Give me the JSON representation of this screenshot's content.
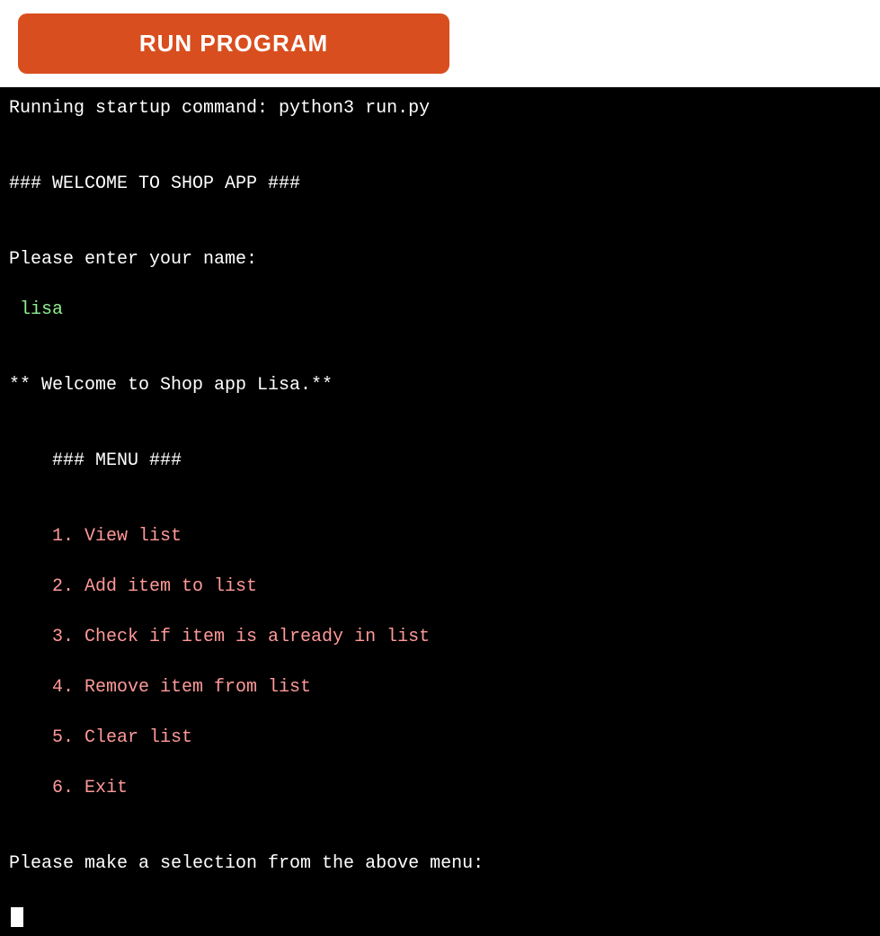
{
  "header": {
    "run_button_label": "RUN PROGRAM"
  },
  "terminal": {
    "lines": [
      {
        "text": "Running startup command: python3 run.py",
        "type": "normal"
      },
      {
        "text": "",
        "type": "normal"
      },
      {
        "text": "### WELCOME TO SHOP APP ###",
        "type": "normal"
      },
      {
        "text": "",
        "type": "normal"
      },
      {
        "text": "Please enter your name:",
        "type": "normal"
      },
      {
        "text": " lisa",
        "type": "input"
      },
      {
        "text": "",
        "type": "normal"
      },
      {
        "text": "** Welcome to Shop app Lisa.**",
        "type": "normal"
      },
      {
        "text": "",
        "type": "normal"
      },
      {
        "text": "    ### MENU ###",
        "type": "normal"
      },
      {
        "text": "",
        "type": "normal"
      },
      {
        "text": "    1. View list",
        "type": "menu"
      },
      {
        "text": "    2. Add item to list",
        "type": "menu"
      },
      {
        "text": "    3. Check if item is already in list",
        "type": "menu"
      },
      {
        "text": "    4. Remove item from list",
        "type": "menu"
      },
      {
        "text": "    5. Clear list",
        "type": "menu"
      },
      {
        "text": "    6. Exit",
        "type": "menu"
      },
      {
        "text": "",
        "type": "normal"
      },
      {
        "text": "Please make a selection from the above menu:",
        "type": "normal"
      }
    ],
    "cursor": true
  }
}
